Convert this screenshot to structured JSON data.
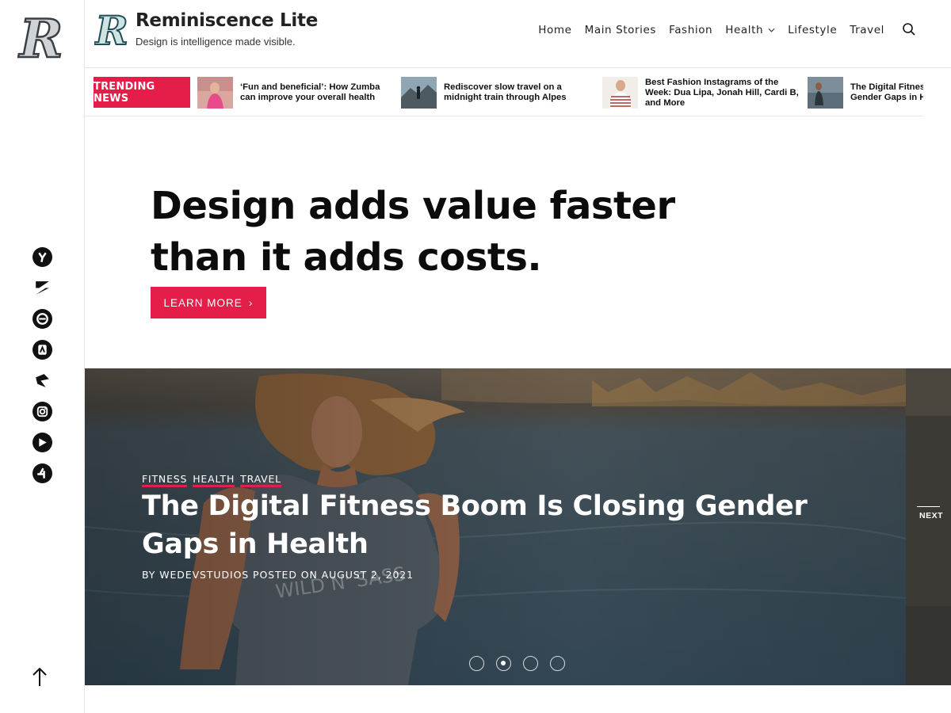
{
  "site": {
    "title": "Reminiscence Lite",
    "tagline": "Design is intelligence made visible."
  },
  "nav": {
    "items": [
      "Home",
      "Main Stories",
      "Fashion",
      "Health",
      "Lifestyle",
      "Travel"
    ]
  },
  "trending": {
    "label": "TRENDING NEWS",
    "items": [
      "‘Fun and beneficial’: How Zumba can improve your overall health",
      "Rediscover slow travel on a midnight train through Alpes",
      "Best Fashion Instagrams of the Week: Dua Lipa, Jonah Hill, Cardi B, and More",
      "The Digital Fitness Boom Is Closing Gender Gaps in Health"
    ]
  },
  "hero": {
    "title": "Design adds value faster than it adds costs.",
    "button": "LEARN MORE"
  },
  "slider": {
    "categories": [
      "FITNESS",
      "HEALTH",
      "TRAVEL"
    ],
    "title": "The Digital Fitness Boom Is Closing Gender Gaps in Health",
    "meta": "BY WEDEVSTUDIOS POSTED ON AUGUST 2, 2021",
    "next_label": "NEXT",
    "slide_count": 4,
    "active_slide": 2
  },
  "social": {
    "icons": [
      "social-icon-1",
      "social-icon-2",
      "social-icon-3",
      "social-icon-4",
      "social-icon-5",
      "instagram-icon",
      "social-icon-7",
      "social-icon-8"
    ]
  },
  "colors": {
    "accent": "#e51d49",
    "text": "#111111"
  }
}
